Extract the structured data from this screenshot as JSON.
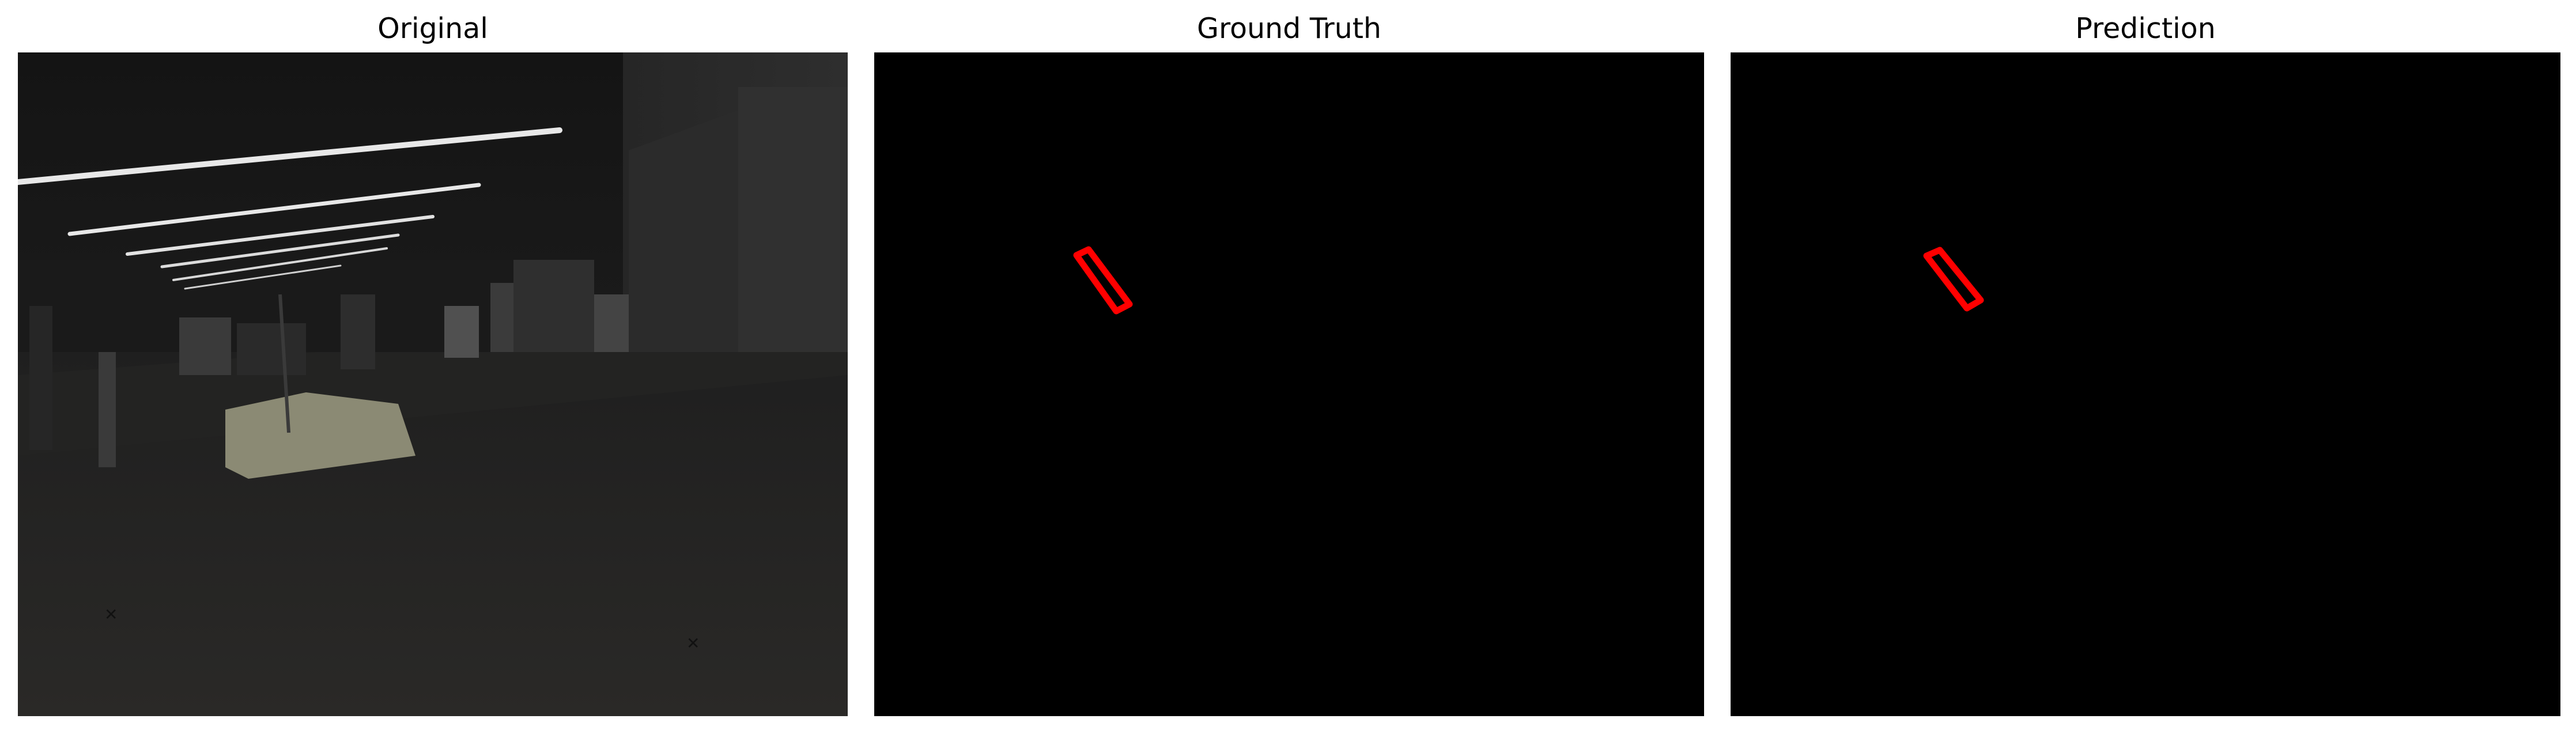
{
  "panels": [
    {
      "title": "Original"
    },
    {
      "title": "Ground Truth"
    },
    {
      "title": "Prediction"
    }
  ],
  "colors": {
    "background": "#ffffff",
    "mask_background": "#000000",
    "mask_outline": "#ff0000"
  }
}
